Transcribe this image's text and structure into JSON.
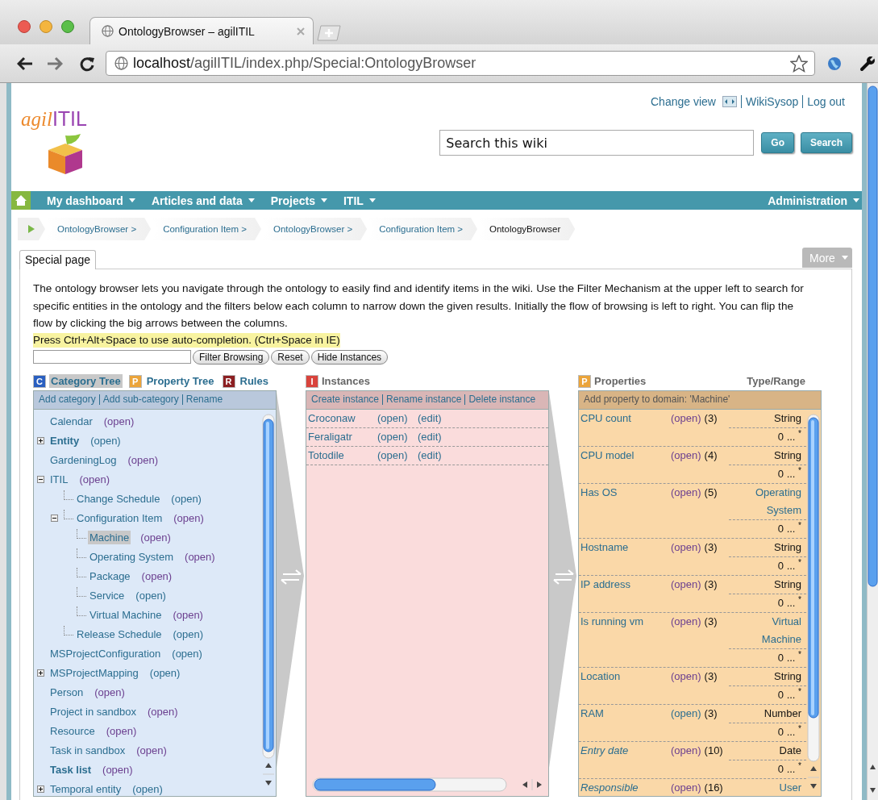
{
  "browser": {
    "tab_title": "OntologyBrowser – agilITIL",
    "address_host": "localhost",
    "address_path": "/agilITIL/index.php/Special:OntologyBrowser"
  },
  "header": {
    "logo_prefix": "agil",
    "logo_suffix": "ITIL",
    "user_links": [
      "Change view",
      "WikiSysop",
      "Log out"
    ],
    "search": {
      "value": "Search this wiki"
    },
    "buttons": [
      "Go",
      "Search"
    ]
  },
  "nav": {
    "items": [
      "My dashboard",
      "Articles and data",
      "Projects",
      "ITIL"
    ],
    "right_item": "Administration"
  },
  "breadcrumb": [
    {
      "label": "OntologyBrowser >",
      "current": false
    },
    {
      "label": "Configuration Item >",
      "current": false
    },
    {
      "label": "OntologyBrowser >",
      "current": false
    },
    {
      "label": "Configuration Item >",
      "current": false
    },
    {
      "label": "OntologyBrowser",
      "current": true
    }
  ],
  "page_tabs": [
    {
      "label": "Special page",
      "selected": true
    }
  ],
  "more_button": "More",
  "description": "The ontology browser lets you navigate through the ontology to easily find and identify items in the wiki. Use the Filter Mechanism at the upper left to search for specific entities in the ontology and the filters below each column to narrow down the given results. Initially the flow of browsing is left to right. You can flip the flow by clicking the big arrows between the columns.",
  "hint": "Press Ctrl+Alt+Space to use auto-completion. (Ctrl+Space in IE)",
  "filter": {
    "buttons": [
      "Filter Browsing",
      "Reset",
      "Hide Instances"
    ]
  },
  "tree_column": {
    "tabs": [
      {
        "badge": "C",
        "label": "Category Tree",
        "color": "#2a5fc0",
        "selected": true
      },
      {
        "badge": "P",
        "label": "Property Tree",
        "color": "#eba43a",
        "selected": false
      },
      {
        "badge": "R",
        "label": "Rules",
        "color": "#8c1f22",
        "selected": false
      }
    ],
    "actions": [
      "Add category",
      "Add sub-category",
      "Rename"
    ],
    "items": [
      {
        "label": "Calendar",
        "open": "(open)",
        "bold": false,
        "kind": "leaf",
        "selected": false,
        "open_visited": true
      },
      {
        "label": "Entity",
        "open": "(open)",
        "bold": true,
        "kind": "collapsed",
        "selected": false,
        "open_visited": false
      },
      {
        "label": "GardeningLog",
        "open": "(open)",
        "bold": false,
        "kind": "leaf",
        "selected": false,
        "open_visited": true
      },
      {
        "label": "ITIL",
        "open": "(open)",
        "bold": false,
        "kind": "expanded",
        "selected": false,
        "open_visited": true,
        "children": [
          {
            "label": "Change Schedule",
            "open": "(open)",
            "bold": false,
            "kind": "leaf",
            "selected": false,
            "open_visited": false
          },
          {
            "label": "Configuration Item",
            "open": "(open)",
            "bold": false,
            "kind": "expanded",
            "selected": false,
            "open_visited": true,
            "children": [
              {
                "label": "Machine",
                "open": "(open)",
                "bold": false,
                "kind": "leaf",
                "selected": true,
                "open_visited": true
              },
              {
                "label": "Operating System",
                "open": "(open)",
                "bold": false,
                "kind": "leaf",
                "selected": false,
                "open_visited": true
              },
              {
                "label": "Package",
                "open": "(open)",
                "bold": false,
                "kind": "leaf",
                "selected": false,
                "open_visited": true
              },
              {
                "label": "Service",
                "open": "(open)",
                "bold": false,
                "kind": "leaf",
                "selected": false,
                "open_visited": false
              },
              {
                "label": "Virtual Machine",
                "open": "(open)",
                "bold": false,
                "kind": "leaf",
                "selected": false,
                "open_visited": true
              }
            ]
          },
          {
            "label": "Release Schedule",
            "open": "(open)",
            "bold": false,
            "kind": "leaf",
            "selected": false,
            "open_visited": false
          }
        ]
      },
      {
        "label": "MSProjectConfiguration",
        "open": "(open)",
        "bold": false,
        "kind": "leaf",
        "selected": false,
        "open_visited": false
      },
      {
        "label": "MSProjectMapping",
        "open": "(open)",
        "bold": false,
        "kind": "collapsed",
        "selected": false,
        "open_visited": false
      },
      {
        "label": "Person",
        "open": "(open)",
        "bold": false,
        "kind": "leaf",
        "selected": false,
        "open_visited": true
      },
      {
        "label": "Project in sandbox",
        "open": "(open)",
        "bold": false,
        "kind": "leaf",
        "selected": false,
        "open_visited": true
      },
      {
        "label": "Resource",
        "open": "(open)",
        "bold": false,
        "kind": "leaf",
        "selected": false,
        "open_visited": true
      },
      {
        "label": "Task in sandbox",
        "open": "(open)",
        "bold": false,
        "kind": "leaf",
        "selected": false,
        "open_visited": true
      },
      {
        "label": "Task list",
        "open": "(open)",
        "bold": true,
        "kind": "leaf",
        "selected": false,
        "open_visited": true
      },
      {
        "label": "Temporal entity",
        "open": "(open)",
        "bold": false,
        "kind": "collapsed",
        "selected": false,
        "open_visited": false
      }
    ]
  },
  "instances_column": {
    "badge": "I",
    "title": "Instances",
    "actions": [
      "Create instance",
      "Rename instance",
      "Delete instance"
    ],
    "rows": [
      {
        "name": "Croconaw",
        "open": "(open)",
        "edit": "(edit)"
      },
      {
        "name": "Feraligatr",
        "open": "(open)",
        "edit": "(edit)"
      },
      {
        "name": "Totodile",
        "open": "(open)",
        "edit": "(edit)"
      }
    ]
  },
  "properties_column": {
    "badge": "P",
    "title": "Properties",
    "type_header": "Type/Range",
    "action": "Add property to domain: 'Machine'",
    "rows": [
      {
        "name": "CPU count",
        "italic": false,
        "open": "(open)",
        "open_visited": true,
        "count": "(3)",
        "type": "String",
        "type_link": false,
        "cardinality": "0 ... $^{*}$"
      },
      {
        "name": "CPU model",
        "italic": false,
        "open": "(open)",
        "open_visited": true,
        "count": "(4)",
        "type": "String",
        "type_link": false,
        "cardinality": "0 ... $^{*}$"
      },
      {
        "name": "Has OS",
        "italic": false,
        "open": "(open)",
        "open_visited": true,
        "count": "(5)",
        "type": "Operating System",
        "type_link": true,
        "cardinality": "0 ... $^{*}$"
      },
      {
        "name": "Hostname",
        "italic": false,
        "open": "(open)",
        "open_visited": true,
        "count": "(3)",
        "type": "String",
        "type_link": false,
        "cardinality": "0 ... $^{*}$"
      },
      {
        "name": "IP address",
        "italic": false,
        "open": "(open)",
        "open_visited": true,
        "count": "(3)",
        "type": "String",
        "type_link": false,
        "cardinality": "0 ... $^{*}$"
      },
      {
        "name": "Is running vm",
        "italic": false,
        "open": "(open)",
        "open_visited": true,
        "count": "(3)",
        "type": "Virtual Machine",
        "type_link": true,
        "cardinality": "0 ... $^{*}$"
      },
      {
        "name": "Location",
        "italic": false,
        "open": "(open)",
        "open_visited": true,
        "count": "(3)",
        "type": "String",
        "type_link": false,
        "cardinality": "0 ... $^{*}$"
      },
      {
        "name": "RAM",
        "italic": false,
        "open": "(open)",
        "open_visited": false,
        "count": "(3)",
        "type": "Number",
        "type_link": false,
        "cardinality": "0 ... $^{*}$"
      },
      {
        "name": "Entry date",
        "italic": true,
        "open": "(open)",
        "open_visited": true,
        "count": "(10)",
        "type": "Date",
        "type_link": false,
        "cardinality": "0 ... $^{*}$"
      },
      {
        "name": "Responsible",
        "italic": true,
        "open": "(open)",
        "open_visited": true,
        "count": "(16)",
        "type": "User",
        "type_link": true
      }
    ]
  }
}
